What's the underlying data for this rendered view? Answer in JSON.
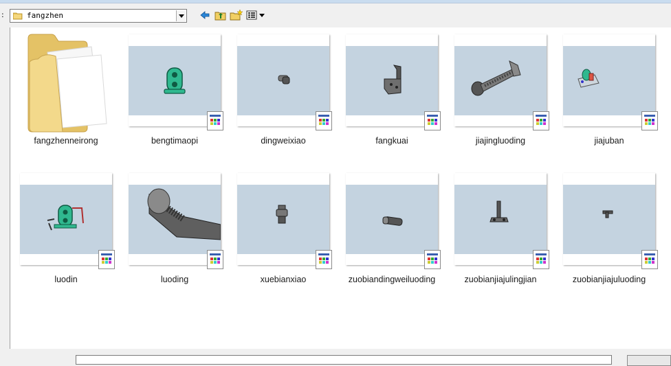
{
  "lookin": {
    "colon": ":",
    "current_folder": "fangzhen"
  },
  "toolbar": {
    "back_icon": "back-arrow-icon",
    "up_icon": "up-folder-icon",
    "new_folder_icon": "new-folder-icon",
    "view_menu_icon": "view-menu-icon"
  },
  "items": [
    {
      "label": "fangzhenneirong",
      "type": "folder"
    },
    {
      "label": "bengtimaopi",
      "type": "part"
    },
    {
      "label": "dingweixiao",
      "type": "part"
    },
    {
      "label": "fangkuai",
      "type": "part"
    },
    {
      "label": "jiajingluoding",
      "type": "part"
    },
    {
      "label": "jiajuban",
      "type": "part"
    },
    {
      "label": "luodin",
      "type": "part"
    },
    {
      "label": "luoding",
      "type": "part"
    },
    {
      "label": "xuebianxiao",
      "type": "part"
    },
    {
      "label": "zuobiandingweiluoding",
      "type": "part"
    },
    {
      "label": "zuobianjiajulingjian",
      "type": "part"
    },
    {
      "label": "zuobianjiajuluoding",
      "type": "part"
    }
  ],
  "colors": {
    "viewport_bg": "#c4d3e0",
    "part_green": "#2fb88f",
    "part_gray": "#6b6b6b"
  }
}
